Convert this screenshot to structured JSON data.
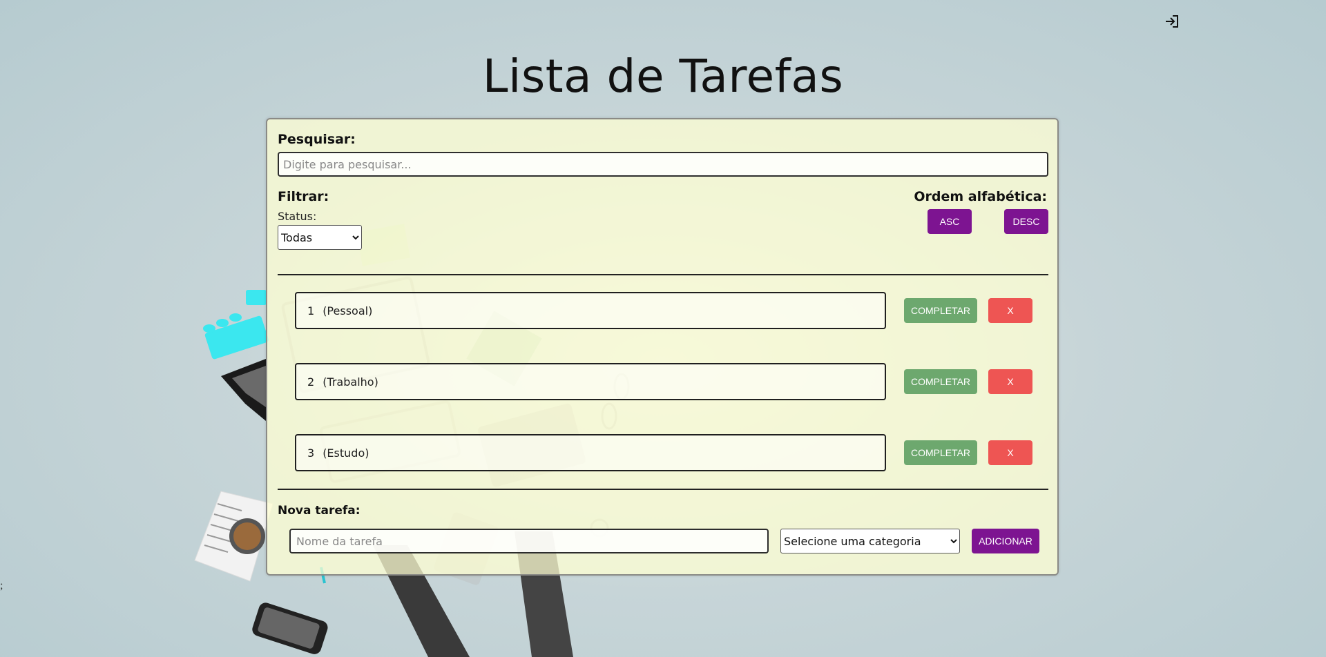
{
  "page_title": "Lista de Tarefas",
  "header": {
    "login_icon": "login-icon"
  },
  "stray_text": ";",
  "search": {
    "label": "Pesquisar:",
    "placeholder": "Digite para pesquisar...",
    "value": ""
  },
  "filter": {
    "label": "Filtrar:",
    "status_label": "Status:",
    "status_selected": "Todas"
  },
  "order": {
    "label": "Ordem alfabética:",
    "asc_label": "ASC",
    "desc_label": "DESC"
  },
  "tasks": [
    {
      "number": "1",
      "category": "(Pessoal)",
      "complete_label": "COMPLETAR",
      "delete_label": "X"
    },
    {
      "number": "2",
      "category": "(Trabalho)",
      "complete_label": "COMPLETAR",
      "delete_label": "X"
    },
    {
      "number": "3",
      "category": "(Estudo)",
      "complete_label": "COMPLETAR",
      "delete_label": "X"
    }
  ],
  "new_task": {
    "label": "Nova tarefa:",
    "name_placeholder": "Nome da tarefa",
    "category_selected": "Selecione uma categoria",
    "add_label": "ADICIONAR"
  },
  "colors": {
    "accent_purple": "#7d1491",
    "complete_green": "#6da86e",
    "delete_red": "#ee5553",
    "panel_background": "#ffffd2",
    "page_background": "#c7d5d8"
  }
}
